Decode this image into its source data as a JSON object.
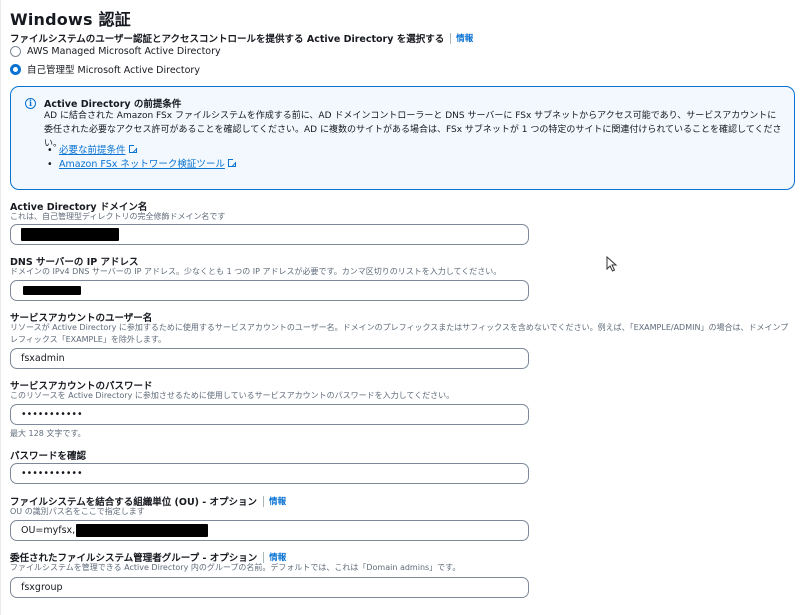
{
  "section": {
    "title": "Windows 認証",
    "question": "ファイルシステムのユーザー認証とアクセスコントロールを提供する Active Directory を選択する",
    "info_label": "情報",
    "options": [
      {
        "label": "AWS Managed Microsoft Active Directory",
        "selected": false
      },
      {
        "label": "自己管理型 Microsoft Active Directory",
        "selected": true
      }
    ]
  },
  "alert": {
    "title": "Active Directory の前提条件",
    "body": "AD に結合された Amazon FSx ファイルシステムを作成する前に、AD ドメインコントローラーと DNS サーバーに FSx サブネットからアクセス可能であり、サービスアカウントに委任された必要なアクセス許可があることを確認してください。AD に複数のサイトがある場合は、FSx サブネットが 1 つの特定のサイトに関連付けられていることを確認してください。",
    "links": [
      "必要な前提条件",
      "Amazon FSx ネットワーク検証ツール"
    ]
  },
  "fields": {
    "domain": {
      "label": "Active Directory ドメイン名",
      "description": "これは、自己管理型ディレクトリの完全修飾ドメイン名です"
    },
    "dns": {
      "label": "DNS サーバーの IP アドレス",
      "description": "ドメインの IPv4 DNS サーバーの IP アドレス。少なくとも 1 つの IP アドレスが必要です。カンマ区切りのリストを入力してください。"
    },
    "username": {
      "label": "サービスアカウントのユーザー名",
      "description": "リソースが Active Directory に参加するために使用するサービスアカウントのユーザー名。ドメインのプレフィックスまたはサフィックスを含めないでください。例えば、「EXAMPLE/ADMIN」の場合は、ドメインプレフィックス「EXAMPLE」を除外します。",
      "value": "fsxadmin"
    },
    "password": {
      "label": "サービスアカウントのパスワード",
      "description": "このリソースを Active Directory に参加させるために使用しているサービスアカウントのパスワードを入力してください。",
      "value": "•••••••••••",
      "constraint": "最大 128 文字です。"
    },
    "confirm": {
      "label": "パスワードを確認",
      "value": "•••••••••••"
    },
    "ou": {
      "label": "ファイルシステムを結合する組織単位 (OU) - オプション",
      "info_label": "情報",
      "description": "OU の識別パス名をここで指定します",
      "value": "OU=myfsx,"
    },
    "admin_group": {
      "label": "委任されたファイルシステム管理者グループ - オプション",
      "info_label": "情報",
      "description": "ファイルシステムを管理できる Active Directory 内のグループの名前。デフォルトでは、これは「Domain admins」です。",
      "value": "fsxgroup"
    }
  },
  "colors": {
    "accent": "#0972d3",
    "alert_bg": "#f2f8fd",
    "text": "#16191f",
    "muted": "#5f6b7a",
    "border": "#7d8998"
  }
}
